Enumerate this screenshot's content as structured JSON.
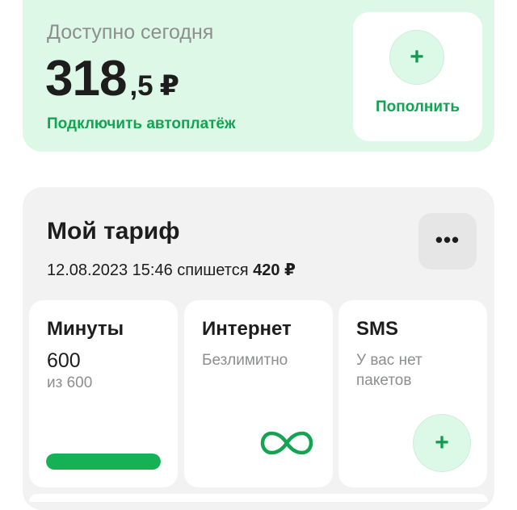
{
  "balance": {
    "caption": "Доступно сегодня",
    "amount_int": "318",
    "amount_frac": ",5",
    "currency": "₽",
    "autopay_link": "Подключить автоплатёж",
    "topup": {
      "plus_glyph": "+",
      "label": "Пополнить"
    }
  },
  "tariff": {
    "title": "Мой тариф",
    "charge_prefix": "12.08.2023 15:46 спишется",
    "charge_amount": "420 ₽",
    "more_glyph": "•••",
    "packs": {
      "minutes": {
        "title": "Минуты",
        "value": "600",
        "subtitle": "из 600",
        "progress_fraction": 1.0
      },
      "internet": {
        "title": "Интернет",
        "status": "Безлимитно",
        "icon": "infinity-icon"
      },
      "sms": {
        "title": "SMS",
        "status": "У вас нет пакетов",
        "add_glyph": "+"
      }
    }
  },
  "colors": {
    "accent_green": "#12a453",
    "balance_bg": "#def8e7",
    "progress_fill": "#17b155",
    "section_bg": "#f2f2f2"
  }
}
